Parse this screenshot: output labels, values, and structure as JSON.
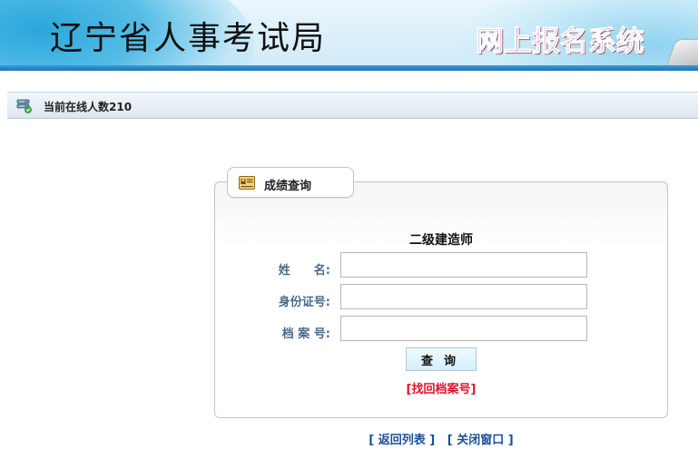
{
  "header": {
    "title": "辽宁省人事考试局",
    "system_chars": [
      "网",
      "上",
      "报",
      "名",
      "系",
      "统"
    ],
    "system_colors": [
      "#d61d7c",
      "#7a1fa0",
      "#c8157e",
      "#d4237f",
      "#8a2ab0",
      "#b5197f"
    ]
  },
  "online_bar": {
    "icon": "server-status-icon",
    "text": "当前在线人数210"
  },
  "panel": {
    "tab_icon": "id-card-icon",
    "tab_label": "成绩查询",
    "exam_name": "二级建造师",
    "fields": [
      {
        "label": "姓　　名:",
        "value": "",
        "placeholder": ""
      },
      {
        "label": "身份证号:",
        "value": "",
        "placeholder": ""
      },
      {
        "label": "档 案 号:",
        "value": "",
        "placeholder": ""
      }
    ],
    "query_button": "查询",
    "retrieve_link": "[找回档案号]"
  },
  "footer": {
    "back_link": "[ 返回列表 ]",
    "close_link": "[ 关闭窗口 ]"
  },
  "colors": {
    "label": "#4a6a8c",
    "retrieve_link": "#e0122e",
    "footer_link": "#1b4f9c",
    "banner_stripe": "#1e73b8"
  }
}
